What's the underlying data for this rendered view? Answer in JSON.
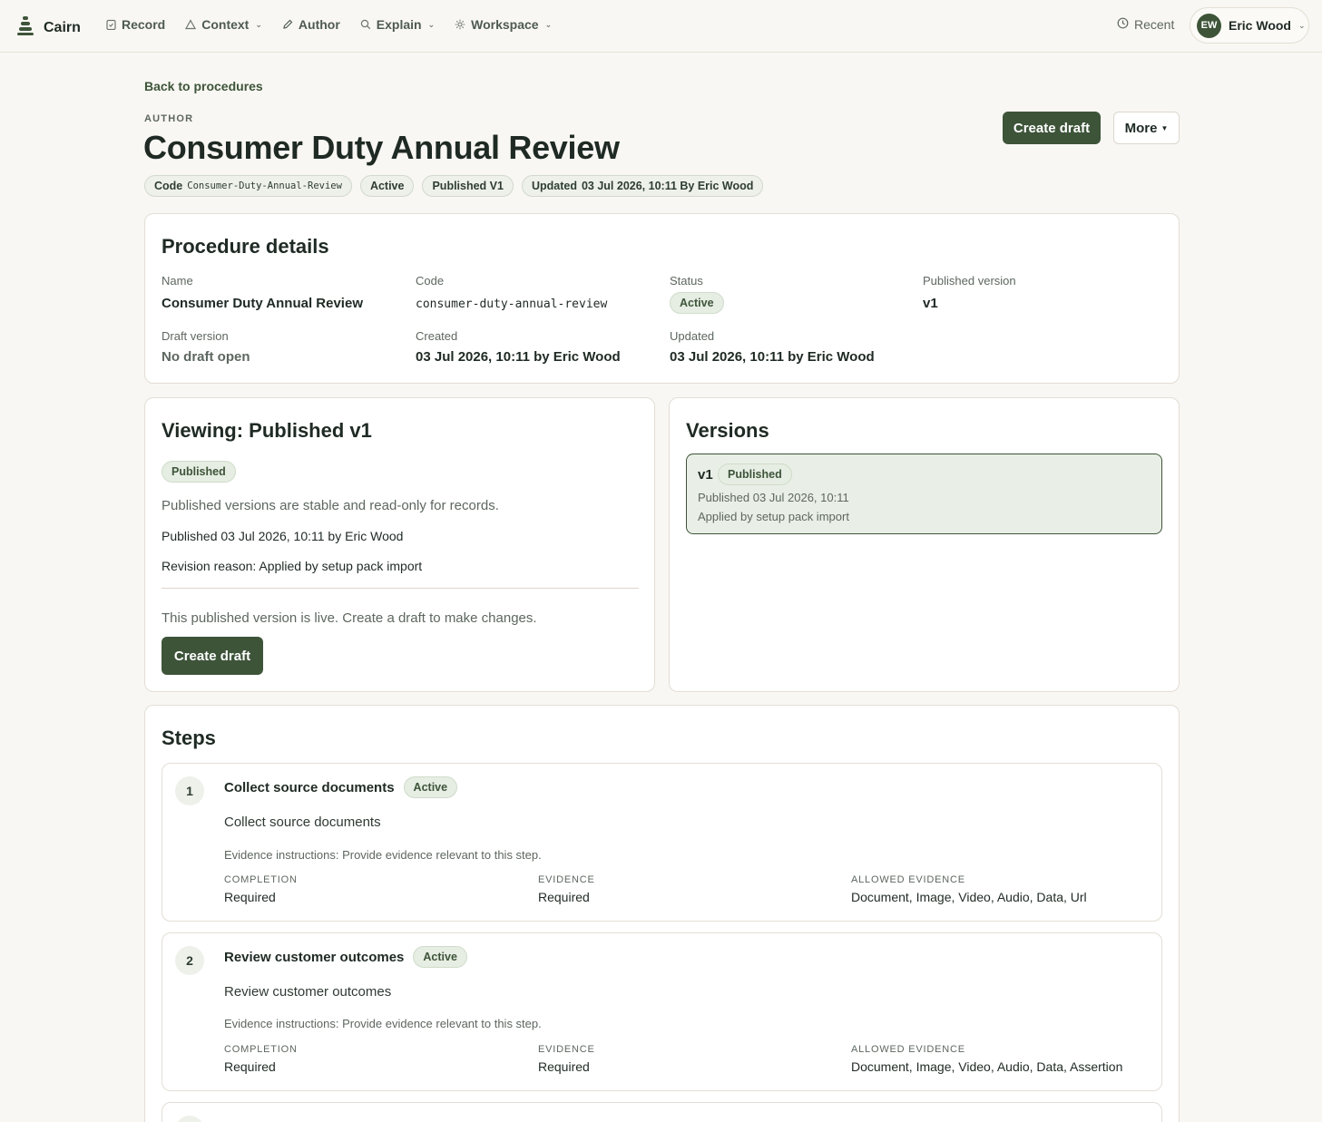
{
  "nav": {
    "brand": "Cairn",
    "items": [
      {
        "label": "Record",
        "icon": "clipboard-icon",
        "has_menu": false
      },
      {
        "label": "Context",
        "icon": "triangle-icon",
        "has_menu": true
      },
      {
        "label": "Author",
        "icon": "pencil-icon",
        "has_menu": false
      },
      {
        "label": "Explain",
        "icon": "search-icon",
        "has_menu": true
      },
      {
        "label": "Workspace",
        "icon": "gear-icon",
        "has_menu": true
      }
    ],
    "recent": "Recent",
    "user_initials": "EW",
    "user_name": "Eric Wood"
  },
  "header": {
    "back_link": "Back to procedures",
    "eyebrow": "AUTHOR",
    "title": "Consumer Duty Annual Review",
    "create_draft": "Create draft",
    "more": "More",
    "chips": {
      "code_label": "Code",
      "code_value": "Consumer-Duty-Annual-Review",
      "status": "Active",
      "published": "Published V1",
      "updated_label": "Updated",
      "updated_value": "03 Jul 2026, 10:11 By Eric Wood"
    }
  },
  "details": {
    "title": "Procedure details",
    "name_label": "Name",
    "name_value": "Consumer Duty Annual Review",
    "code_label": "Code",
    "code_value": "consumer-duty-annual-review",
    "status_label": "Status",
    "status_value": "Active",
    "published_label": "Published version",
    "published_value": "v1",
    "draft_label": "Draft version",
    "draft_value": "No draft open",
    "created_label": "Created",
    "created_value": "03 Jul 2026, 10:11 by Eric Wood",
    "updated_label": "Updated",
    "updated_value": "03 Jul 2026, 10:11 by Eric Wood"
  },
  "viewing": {
    "title": "Viewing: Published v1",
    "badge": "Published",
    "note": "Published versions are stable and read-only for records.",
    "published_line": "Published 03 Jul 2026, 10:11 by Eric Wood",
    "revision_line": "Revision reason: Applied by setup pack import",
    "live_note": "This published version is live. Create a draft to make changes.",
    "create_draft": "Create draft"
  },
  "versions": {
    "title": "Versions",
    "items": [
      {
        "version": "v1",
        "badge": "Published",
        "published": "Published 03 Jul 2026, 10:11",
        "reason": "Applied by setup pack import"
      }
    ]
  },
  "steps": {
    "title": "Steps",
    "completion_label": "COMPLETION",
    "evidence_label": "EVIDENCE",
    "allowed_label": "ALLOWED EVIDENCE",
    "items": [
      {
        "number": "1",
        "title": "Collect source documents",
        "badge": "Active",
        "description": "Collect source documents",
        "instructions": "Evidence instructions: Provide evidence relevant to this step.",
        "completion": "Required",
        "evidence": "Required",
        "allowed": "Document, Image, Video, Audio, Data, Url"
      },
      {
        "number": "2",
        "title": "Review customer outcomes",
        "badge": "Active",
        "description": "Review customer outcomes",
        "instructions": "Evidence instructions: Provide evidence relevant to this step.",
        "completion": "Required",
        "evidence": "Required",
        "allowed": "Document, Image, Video, Audio, Data, Assertion"
      }
    ]
  },
  "colors": {
    "accent": "#3d5439",
    "background": "#f9f7f3",
    "badge_bg": "#e6ede3",
    "version_selected_bg": "#e9efe6"
  }
}
